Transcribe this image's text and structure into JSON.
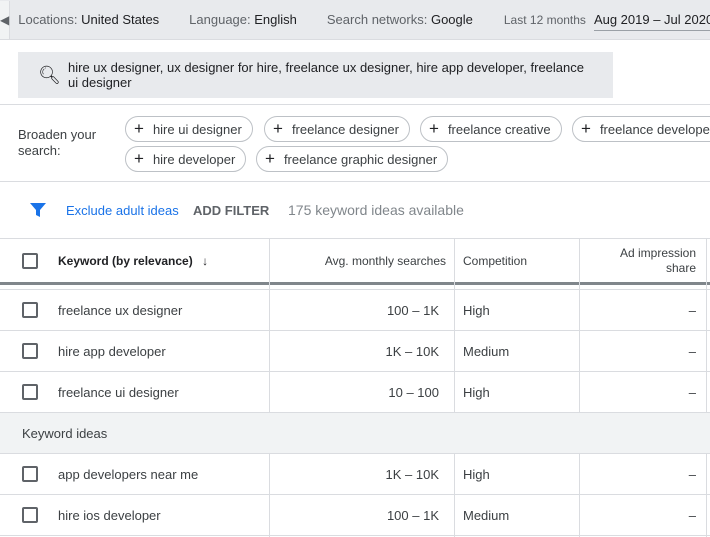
{
  "topbar": {
    "locations_label": "Locations:",
    "locations_value": "United States",
    "language_label": "Language:",
    "language_value": "English",
    "networks_label": "Search networks:",
    "networks_value": "Google",
    "period_label": "Last 12 months",
    "period_value": "Aug 2019 – Jul 2020"
  },
  "search": {
    "value": "hire ux designer, ux designer for hire, freelance ux designer, hire app developer, freelance ui designer"
  },
  "broaden": {
    "label": "Broaden your search:",
    "chips": [
      "hire ui designer",
      "freelance designer",
      "freelance creative",
      "freelance developer",
      "hire developer",
      "freelance graphic designer"
    ]
  },
  "filters": {
    "exclude": "Exclude adult ideas",
    "add": "ADD FILTER",
    "count": "175 keyword ideas available"
  },
  "table": {
    "headers": {
      "keyword": "Keyword (by relevance)",
      "searches": "Avg. monthly searches",
      "competition": "Competition",
      "impression": "Ad impression share"
    },
    "rows": [
      {
        "keyword": "freelance ux designer",
        "searches": "100 – 1K",
        "competition": "High",
        "impression": "–"
      },
      {
        "keyword": "hire app developer",
        "searches": "1K – 10K",
        "competition": "Medium",
        "impression": "–"
      },
      {
        "keyword": "freelance ui designer",
        "searches": "10 – 100",
        "competition": "High",
        "impression": "–"
      }
    ],
    "section": "Keyword ideas",
    "ideas": [
      {
        "keyword": "app developers near me",
        "searches": "1K – 10K",
        "competition": "High",
        "impression": "–"
      },
      {
        "keyword": "hire ios developer",
        "searches": "100 – 1K",
        "competition": "Medium",
        "impression": "–"
      }
    ]
  }
}
